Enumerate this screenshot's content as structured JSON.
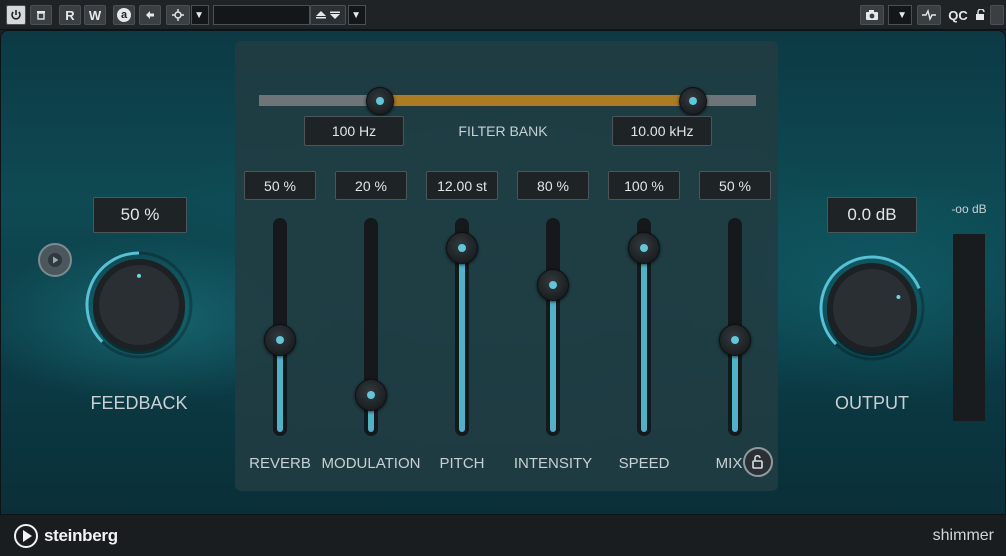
{
  "toolbar": {
    "record_label": "R",
    "write_label": "W",
    "auto_label": "a",
    "preset_name": "",
    "qc_label": "QC"
  },
  "filter_bank": {
    "title": "FILTER BANK",
    "low_value": "100 Hz",
    "high_value": "10.00 kHz",
    "low_fraction": 0.244,
    "high_fraction": 0.874
  },
  "feedback": {
    "label": "FEEDBACK",
    "value": "50 %",
    "fraction": 0.5
  },
  "output": {
    "label": "OUTPUT",
    "value": "0.0 dB",
    "fraction": 0.75
  },
  "meter": {
    "label": "-oo dB"
  },
  "sliders": [
    {
      "name": "reverb",
      "label": "REVERB",
      "value": "50 %",
      "fraction": 0.5
    },
    {
      "name": "modulation",
      "label": "MODULATION",
      "value": "20 %",
      "fraction": 0.2
    },
    {
      "name": "pitch",
      "label": "PITCH",
      "value": "12.00 st",
      "fraction": 1.0
    },
    {
      "name": "intensity",
      "label": "INTENSITY",
      "value": "80 %",
      "fraction": 0.8
    },
    {
      "name": "speed",
      "label": "SPEED",
      "value": "100 %",
      "fraction": 1.0
    },
    {
      "name": "mix",
      "label": "MIX",
      "value": "50 %",
      "fraction": 0.5
    }
  ],
  "footer": {
    "brand": "steinberg",
    "plugin_name": "shimmer"
  },
  "colors": {
    "accent": "#4db3c7",
    "filter_range": "#b07a1e",
    "background": "#0e4a53"
  }
}
